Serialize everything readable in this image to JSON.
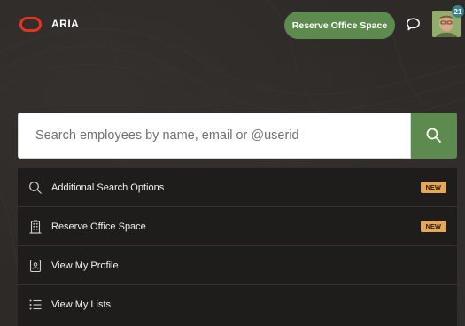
{
  "header": {
    "brand_name": "ARIA",
    "reserve_button_label": "Reserve Office Space",
    "notification_count": "21",
    "icons": {
      "logo": "oracle-ring-logo",
      "chat": "chat-bubble-icon",
      "avatar": "user-avatar"
    }
  },
  "search": {
    "placeholder": "Search employees by name, email or @userid",
    "value": "",
    "button_icon": "search-icon"
  },
  "menu": {
    "items": [
      {
        "label": "Additional Search Options",
        "icon": "search-icon",
        "badge": "NEW"
      },
      {
        "label": "Reserve Office Space",
        "icon": "building-icon",
        "badge": "NEW"
      },
      {
        "label": "View My Profile",
        "icon": "profile-card-icon",
        "badge": ""
      },
      {
        "label": "View My Lists",
        "icon": "list-icon",
        "badge": ""
      }
    ]
  },
  "colors": {
    "accent_green": "#5d8a4e",
    "brand_red": "#e0361f",
    "badge_orange": "#e2a85b",
    "background": "#2d2a27",
    "menu_background": "#1f1d1b",
    "notification_teal": "#3f7f86"
  }
}
